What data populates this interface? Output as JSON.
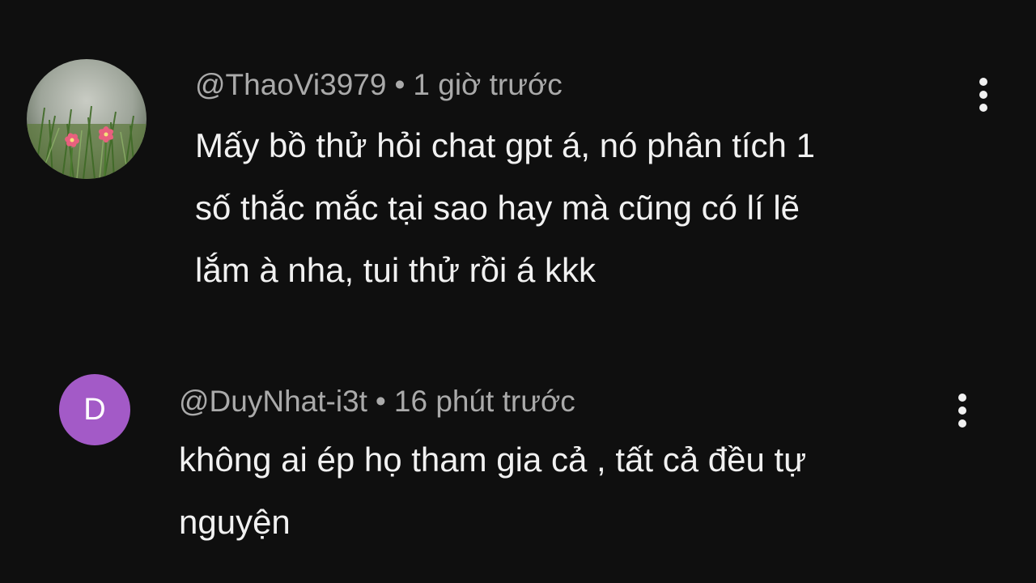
{
  "comments": [
    {
      "author": "@ThaoVi3979",
      "separator": "•",
      "time": "1 giờ trước",
      "text": "Mấy bồ thử hỏi chat gpt á, nó phân tích 1\nsố thắc mắc tại sao hay mà cũng có lí lẽ\nlắm à nha, tui thử rồi á kkk",
      "avatar": "flower-photo"
    },
    {
      "author": "@DuyNhat-i3t",
      "separator": "•",
      "time": "16 phút trước",
      "text": "không ai ép họ tham gia cả , tất cả đều tự\nnguyện",
      "avatar_letter": "D",
      "avatar_color": "#a35ac7"
    }
  ],
  "icons": {
    "menu": "more-vert-icon"
  },
  "colors": {
    "background": "#0f0f0f",
    "meta_text": "#aaaaaa",
    "body_text": "#f1f1f1"
  }
}
